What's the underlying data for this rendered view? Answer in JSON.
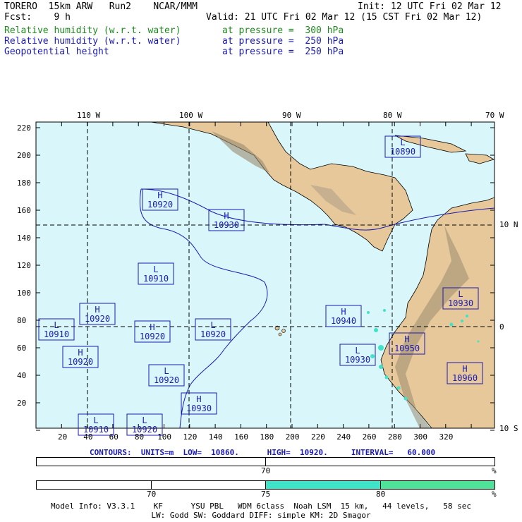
{
  "header": {
    "model": "TORERO  15km ARW   Run2    NCAR/MMM",
    "init": "Init: 12 UTC Fri 02 Mar 12",
    "fcst": "Fcst:    9 h",
    "valid": "Valid: 21 UTC Fri 02 Mar 12 (15 CST Fri 02 Mar 12)",
    "fields": [
      {
        "name": "Relative humidity (w.r.t. water)",
        "level": "at pressure =  300 hPa",
        "color": "#1d8a1d"
      },
      {
        "name": "Relative humidity (w.r.t. water)",
        "level": "at pressure =  250 hPa",
        "color": "#1a1ab4"
      },
      {
        "name": "Geopotential height",
        "level": "at pressure =  250 hPa",
        "color": "#1a1ab4"
      }
    ]
  },
  "map": {
    "lon_labels": [
      "110 W",
      "100 W",
      "90 W",
      "80 W",
      "70 W"
    ],
    "lat_labels": [
      "10 N",
      "0",
      "10 S"
    ],
    "y_ticks": [
      "220",
      "200",
      "180",
      "160",
      "140",
      "120",
      "100",
      "80",
      "60",
      "40",
      "20"
    ],
    "x_ticks": [
      "20",
      "40",
      "60",
      "80",
      "100",
      "120",
      "140",
      "160",
      "180",
      "200",
      "220",
      "240",
      "260",
      "280",
      "300",
      "320"
    ],
    "ocean_color": "#d9f7fb",
    "land_color": "#e6c89a",
    "contour_color": "#1a1ab4",
    "humid_color": "#3fe3c8",
    "systems": [
      {
        "type": "L",
        "value": "10890"
      },
      {
        "type": "H",
        "value": "10920"
      },
      {
        "type": "H",
        "value": "10930"
      },
      {
        "type": "L",
        "value": "10910"
      },
      {
        "type": "H",
        "value": "10920"
      },
      {
        "type": "L",
        "value": "10910"
      },
      {
        "type": "H",
        "value": "10920"
      },
      {
        "type": "L",
        "value": "10920"
      },
      {
        "type": "H",
        "value": "10920"
      },
      {
        "type": "L",
        "value": "10920"
      },
      {
        "type": "H",
        "value": "10930"
      },
      {
        "type": "H",
        "value": "10940"
      },
      {
        "type": "L",
        "value": "10930"
      },
      {
        "type": "H",
        "value": "10950"
      },
      {
        "type": "L",
        "value": "10930"
      },
      {
        "type": "H",
        "value": "10960"
      },
      {
        "type": "L",
        "value": "10910"
      },
      {
        "type": "L",
        "value": "10920"
      }
    ]
  },
  "contours_info": "CONTOURS:  UNITS=m  LOW=  10860.      HIGH=  10920.     INTERVAL=   60.000",
  "colorbar1": {
    "label": "70",
    "unit": "%"
  },
  "colorbar2": {
    "labels": [
      "70",
      "75",
      "80"
    ],
    "unit": "%",
    "fill_colors": [
      "#3fe3c8",
      "#4fe39a"
    ]
  },
  "footer": {
    "line1": "Model Info: V3.3.1    KF      YSU PBL   WDM 6class  Noah LSM  15 km,   44 levels,   58 sec",
    "line2": "LW: Godd SW: Goddard DIFF: simple KM: 2D Smagor"
  }
}
